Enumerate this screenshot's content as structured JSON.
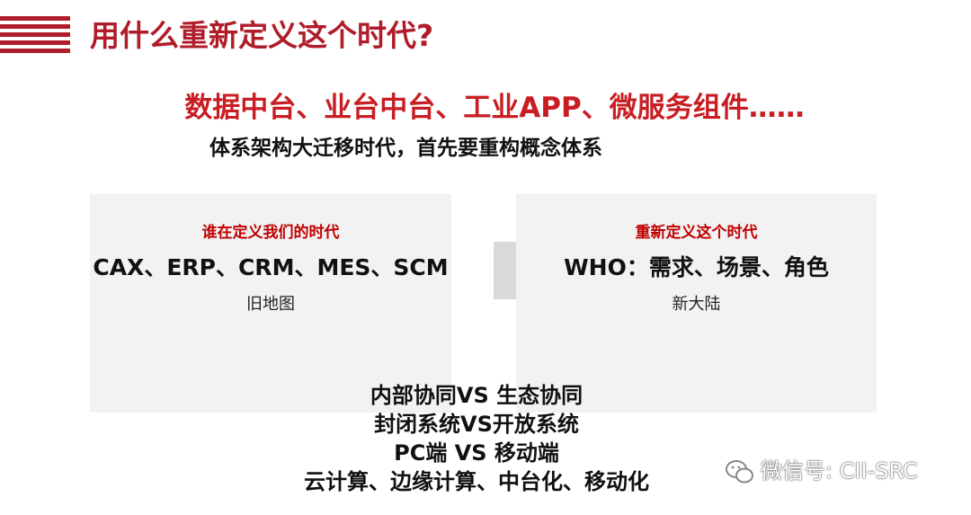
{
  "header": {
    "title": "用什么重新定义这个时代?"
  },
  "headline": "数据中台、业台中台、工业APP、微服务组件……",
  "tagline": "体系架构大迁移时代，首先要重构概念体系",
  "left_panel": {
    "heading": "谁在定义我们的时代",
    "main": "CAX、ERP、CRM、MES、SCM",
    "sub": "旧地图"
  },
  "right_panel": {
    "heading": "重新定义这个时代",
    "main": "WHO：需求、场景、角色",
    "sub": "新大陆"
  },
  "comparisons": [
    "内部协同VS 生态协同",
    "封闭系统VS开放系统",
    "PC端 VS 移动端",
    "云计算、边缘计算、中台化、移动化"
  ],
  "watermark": {
    "text": "微信号: CII-SRC",
    "icon": "wechat-icon"
  },
  "colors": {
    "accent": "#b01d2a",
    "headline": "#c81e23",
    "panel_bg": "#f2f2f2"
  }
}
